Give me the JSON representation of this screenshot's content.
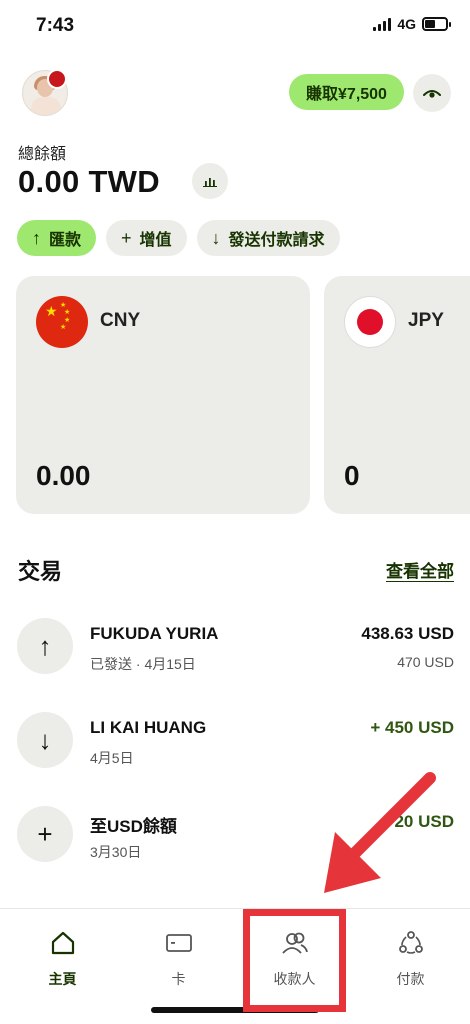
{
  "status_bar": {
    "time": "7:43",
    "network": "4G"
  },
  "header": {
    "earn_label": "賺取¥7,500"
  },
  "balance": {
    "label": "總餘額",
    "value": "0.00 TWD"
  },
  "actions": [
    {
      "icon": "arrow-up-icon",
      "label": "匯款"
    },
    {
      "icon": "plus-icon",
      "label": "增值"
    },
    {
      "icon": "arrow-down-icon",
      "label": "發送付款請求"
    }
  ],
  "cards": [
    {
      "code": "CNY",
      "amount": "0.00",
      "flag": "china-flag-icon"
    },
    {
      "code": "JPY",
      "amount": "0",
      "flag": "japan-flag-icon"
    }
  ],
  "transactions": {
    "title": "交易",
    "view_all": "查看全部",
    "items": [
      {
        "icon": "arrow-up-icon",
        "name": "FUKUDA YURIA",
        "sub": "已發送 · 4月15日",
        "amount": "438.63 USD",
        "amount_sub": "470 USD",
        "positive": false
      },
      {
        "icon": "arrow-down-icon",
        "name": "LI KAI HUANG",
        "sub": "4月5日",
        "amount": "+ 450 USD",
        "amount_sub": "",
        "positive": true
      },
      {
        "icon": "plus-icon",
        "name": "至USD餘額",
        "sub": "3月30日",
        "amount": "+ 20 USD",
        "amount_sub": "",
        "positive": true
      }
    ]
  },
  "nav": [
    {
      "icon": "home-icon",
      "label": "主頁",
      "active": true
    },
    {
      "icon": "card-icon",
      "label": "卡",
      "active": false
    },
    {
      "icon": "recipients-icon",
      "label": "收款人",
      "active": false
    },
    {
      "icon": "payments-icon",
      "label": "付款",
      "active": false
    }
  ],
  "colors": {
    "accent": "#9fe870",
    "accent_text": "#163300",
    "surface": "#ecede8",
    "annotation": "#e5353b",
    "positive": "#2f5711"
  }
}
